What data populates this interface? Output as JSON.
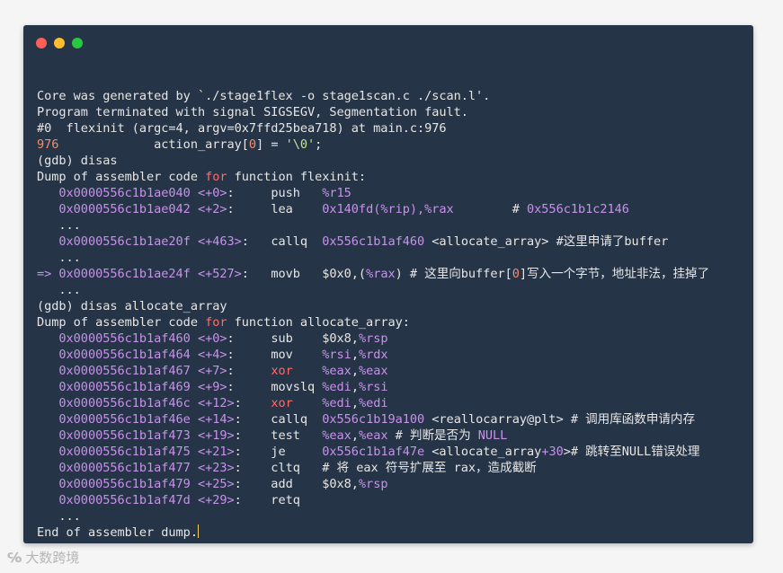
{
  "window": {
    "controls": [
      "close",
      "minimize",
      "maximize"
    ]
  },
  "lines": [
    "Core was generated by `./stage1flex -o stage1scan.c ./scan.l'.",
    "Program terminated with signal SIGSEGV, Segmentation fault.",
    "#0  flexinit (argc=4, argv=0x7ffd25bea718) at main.c:976",
    [
      "976",
      "             action_array[",
      "0",
      "] = ",
      "'\\0'",
      ";"
    ],
    "(gdb) disas",
    [
      "Dump of assembler code ",
      "for",
      " function flexinit:"
    ],
    [
      "   ",
      "0x0000556c1b1ae040",
      " ",
      "<+0>",
      ":     push   ",
      "%r15",
      ""
    ],
    [
      "   ",
      "0x0000556c1b1ae042",
      " ",
      "<+2>",
      ":     lea    ",
      "0x140fd(%rip),%rax",
      "        # ",
      "0x556c1b1c2146"
    ],
    "   ...",
    [
      "   ",
      "0x0000556c1b1ae20f",
      " ",
      "<+463>",
      ":   callq  ",
      "0x556c1b1af460",
      " <allocate_array> #这里申请了buffer"
    ],
    "   ...",
    [
      "=> ",
      "0x0000556c1b1ae24f",
      " ",
      "<+527>",
      ":   movb   $0x0,(",
      "%rax",
      ") # 这里向buffer[",
      "0",
      "]写入一个字节，地址非法，挂掉了"
    ],
    "   ...",
    "(gdb) disas allocate_array",
    [
      "Dump of assembler code ",
      "for",
      " function allocate_array:"
    ],
    [
      "   ",
      "0x0000556c1b1af460",
      " ",
      "<+0>",
      ":     sub    $0x8,",
      "%rsp"
    ],
    [
      "   ",
      "0x0000556c1b1af464",
      " ",
      "<+4>",
      ":     mov    ",
      "%rsi",
      ",",
      "%rdx"
    ],
    [
      "   ",
      "0x0000556c1b1af467",
      " ",
      "<+7>",
      ":     ",
      "xor",
      "    ",
      "%eax",
      ",",
      "%eax"
    ],
    [
      "   ",
      "0x0000556c1b1af469",
      " ",
      "<+9>",
      ":     movslq ",
      "%edi",
      ",",
      "%rsi"
    ],
    [
      "   ",
      "0x0000556c1b1af46c",
      " ",
      "<+12>",
      ":    ",
      "xor",
      "    ",
      "%edi",
      ",",
      "%edi"
    ],
    [
      "   ",
      "0x0000556c1b1af46e",
      " ",
      "<+14>",
      ":    callq  ",
      "0x556c1b19a100",
      " <reallocarray@plt> # 调用库函数申请内存"
    ],
    [
      "   ",
      "0x0000556c1b1af473",
      " ",
      "<+19>",
      ":    test   ",
      "%eax",
      ",",
      "%eax",
      " # 判断是否为 ",
      "NULL"
    ],
    [
      "   ",
      "0x0000556c1b1af475",
      " ",
      "<+21>",
      ":    je     ",
      "0x556c1b1af47e",
      " <allocate_array",
      "+30",
      "># 跳转至NULL错误处理"
    ],
    [
      "   ",
      "0x0000556c1b1af477",
      " ",
      "<+23>",
      ":    cltq   # 将 eax 符号扩展至 rax，造成截断"
    ],
    [
      "   ",
      "0x0000556c1b1af479",
      " ",
      "<+25>",
      ":    add    $0x8,",
      "%rsp"
    ],
    [
      "   ",
      "0x0000556c1b1af47d",
      " ",
      "<+29>",
      ":    retq"
    ],
    "   ...",
    "End of assembler dump."
  ],
  "watermark": {
    "logo": "℅",
    "text": "大数跨境"
  }
}
